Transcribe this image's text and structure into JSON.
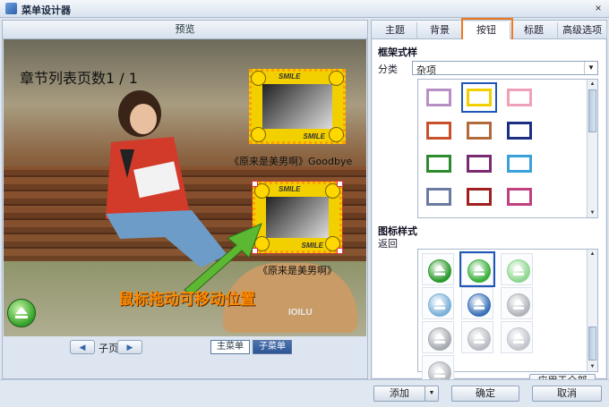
{
  "window": {
    "title": "菜单设计器",
    "close_glyph": "×"
  },
  "preview": {
    "header": "预览",
    "page_label": "章节列表页数1 / 1",
    "frame_texts": {
      "top": "SMILE",
      "bottom": "SMILE"
    },
    "caption1": "《原来是美男啊》Goodbye",
    "caption2": "《原来是美男啊》",
    "hint": "鼠标拖动可移动位置",
    "watermark": "IOILU"
  },
  "pager": {
    "prev_glyph": "◀",
    "label": "子页",
    "next_glyph": "▶"
  },
  "menu_tabs": {
    "main": "主菜单",
    "sub": "子菜单"
  },
  "tabs": [
    {
      "label": "主题",
      "active": false
    },
    {
      "label": "背景",
      "active": false
    },
    {
      "label": "按钮",
      "active": true
    },
    {
      "label": "标题",
      "active": false
    },
    {
      "label": "高级选项",
      "active": false
    }
  ],
  "frame_style": {
    "title": "框架式样",
    "category_label": "分类",
    "category_value": "杂项",
    "thumbnails": [
      {
        "color": "#b690c4",
        "selected": false
      },
      {
        "color": "#f2d000",
        "selected": true
      },
      {
        "color": "#f0a0b8",
        "selected": false
      },
      {
        "color": "#c8502a",
        "selected": false
      },
      {
        "color": "#b06a3a",
        "selected": false
      },
      {
        "color": "#1b2f80",
        "selected": false
      },
      {
        "color": "#2e8a2e",
        "selected": false
      },
      {
        "color": "#7a2a70",
        "selected": false
      },
      {
        "color": "#3aa0d8",
        "selected": false
      },
      {
        "color": "#6a7aa0",
        "selected": false
      },
      {
        "color": "#a02020",
        "selected": false
      },
      {
        "color": "#c04080",
        "selected": false
      }
    ]
  },
  "icon_style": {
    "title": "图标样式",
    "subtitle": "返回",
    "icons": [
      {
        "name": "return-green-dark-icon",
        "color": "#2a9a2a",
        "selected": false
      },
      {
        "name": "return-green-mid-icon",
        "color": "#3ab03a",
        "selected": true
      },
      {
        "name": "return-green-light-icon",
        "color": "#8ed68e",
        "selected": false
      },
      {
        "name": "return-blue-square-icon",
        "color": "#7ab0d8",
        "selected": false
      },
      {
        "name": "return-blue-arrow-icon",
        "color": "#3a70b8",
        "selected": false
      },
      {
        "name": "return-grey-icon",
        "color": "#b0b4ba",
        "selected": false
      },
      {
        "name": "return-grey-icon",
        "color": "#a6aab0",
        "selected": false
      },
      {
        "name": "return-grey-icon",
        "color": "#b8bcc2",
        "selected": false
      },
      {
        "name": "return-grey-icon",
        "color": "#c2c6cc",
        "selected": false
      },
      {
        "name": "return-grey-icon",
        "color": "#b0b4ba",
        "selected": false
      }
    ],
    "apply_label": "应用于全部"
  },
  "bottom": {
    "add": "添加",
    "add_arrow": "▼",
    "ok": "确定",
    "cancel": "取消"
  }
}
